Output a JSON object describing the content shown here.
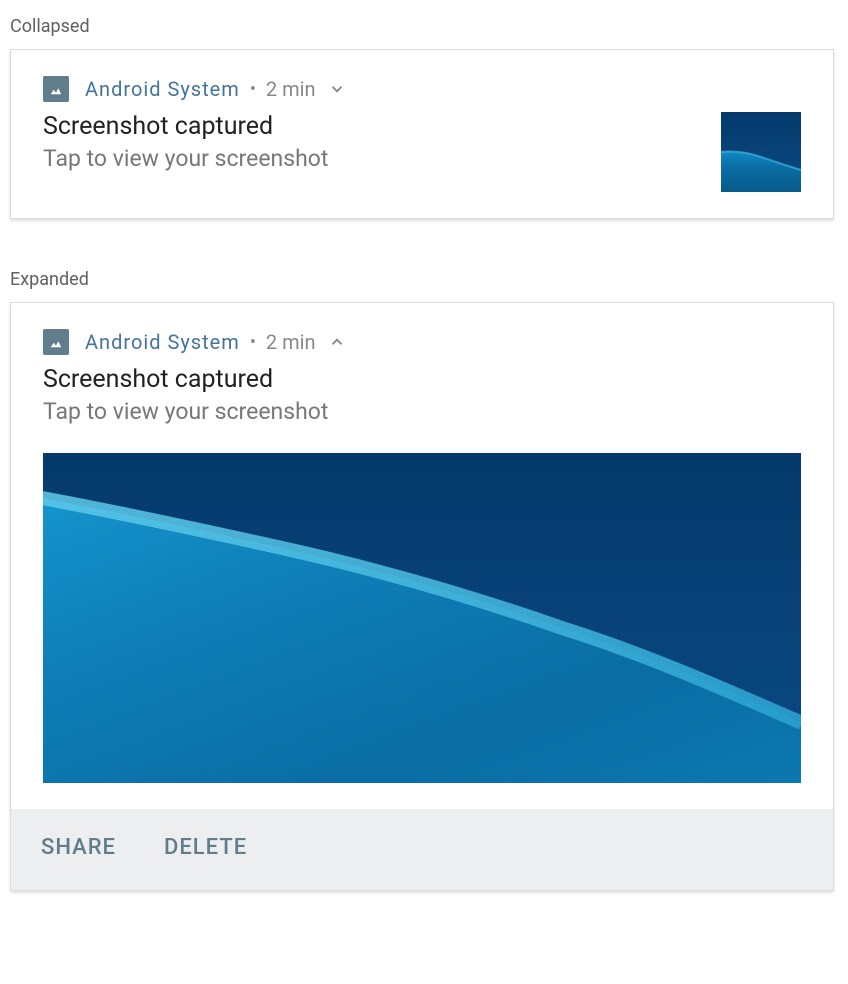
{
  "sections": {
    "collapsed_label": "Collapsed",
    "expanded_label": "Expanded"
  },
  "notification": {
    "app_name": "Android  System",
    "timestamp": "2 min",
    "title": "Screenshot captured",
    "subtitle": "Tap to view your screenshot"
  },
  "actions": {
    "share": "SHARE",
    "delete": "DELETE"
  }
}
